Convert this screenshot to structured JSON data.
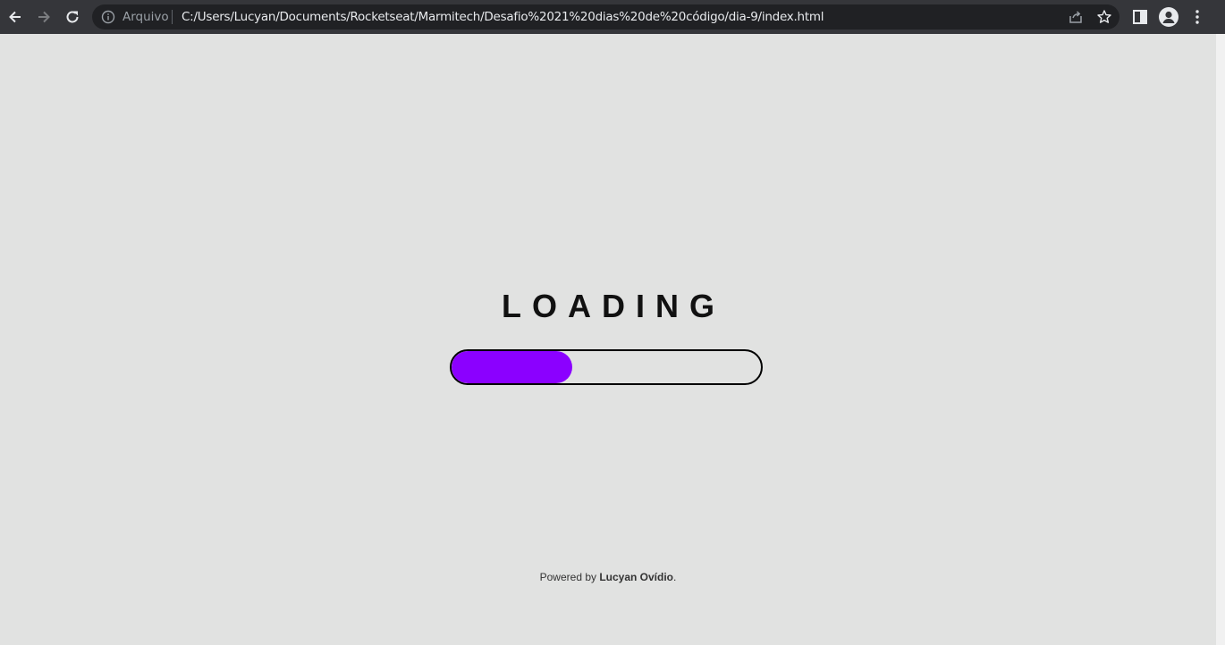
{
  "browser": {
    "scheme_label": "Arquivo",
    "url": "C:/Users/Lucyan/Documents/Rocketseat/Marmitech/Desafio%2021%20dias%20de%20código/dia-9/index.html",
    "icons": {
      "back": "back-arrow-icon",
      "forward": "forward-arrow-icon",
      "reload": "reload-icon",
      "info": "info-icon",
      "share": "share-icon",
      "bookmark": "star-icon",
      "side_panel": "side-panel-icon",
      "profile": "profile-icon",
      "menu": "kebab-menu-icon"
    }
  },
  "main": {
    "title": "LOADING",
    "progress_fraction": 0.39,
    "progress_color": "#8b00ff"
  },
  "footer": {
    "prefix": "Powered by ",
    "author": "Lucyan Ovídio",
    "suffix": "."
  }
}
